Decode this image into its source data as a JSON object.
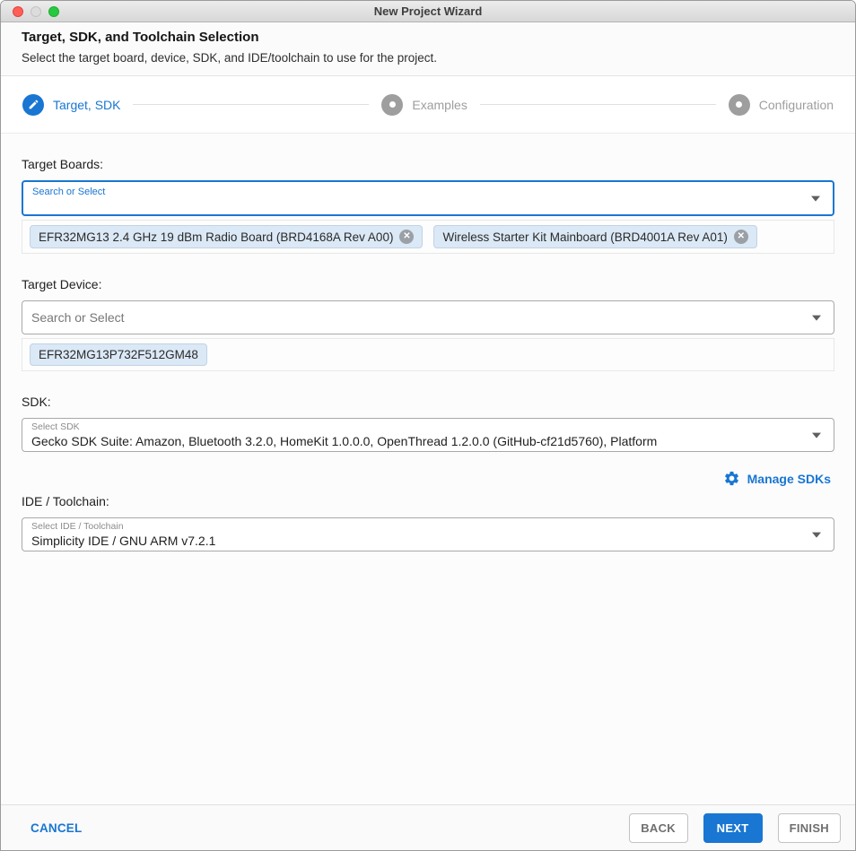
{
  "window": {
    "title": "New Project Wizard"
  },
  "header": {
    "title": "Target, SDK, and Toolchain Selection",
    "subtitle": "Select the target board, device, SDK, and IDE/toolchain to use for the project."
  },
  "stepper": {
    "steps": [
      {
        "label": "Target, SDK",
        "state": "active",
        "icon": "pencil-icon"
      },
      {
        "label": "Examples",
        "state": "inactive",
        "icon": "dot"
      },
      {
        "label": "Configuration",
        "state": "inactive",
        "icon": "dot"
      }
    ]
  },
  "target_boards": {
    "label": "Target Boards:",
    "placeholder": "Search or Select",
    "chips": [
      {
        "label": "EFR32MG13 2.4 GHz 19 dBm Radio Board (BRD4168A Rev A00)",
        "close": "✕"
      },
      {
        "label": "Wireless Starter Kit Mainboard (BRD4001A Rev A01)",
        "close": "✕"
      }
    ]
  },
  "target_device": {
    "label": "Target Device:",
    "placeholder": "Search or Select",
    "chips": [
      {
        "label": "EFR32MG13P732F512GM48"
      }
    ]
  },
  "sdk": {
    "label": "SDK:",
    "select_label": "Select SDK",
    "value": "Gecko SDK Suite: Amazon, Bluetooth 3.2.0, HomeKit 1.0.0.0, OpenThread 1.2.0.0 (GitHub-cf21d5760), Platform",
    "manage_label": "Manage SDKs"
  },
  "ide_toolchain": {
    "label": "IDE / Toolchain:",
    "select_label": "Select IDE / Toolchain",
    "value": "Simplicity IDE / GNU ARM v7.2.1"
  },
  "footer": {
    "cancel": "CANCEL",
    "back": "BACK",
    "next": "NEXT",
    "finish": "FINISH"
  },
  "colors": {
    "accent": "#1976d2",
    "chip_bg": "#dbe8f6",
    "inactive_step": "#9e9e9e"
  }
}
